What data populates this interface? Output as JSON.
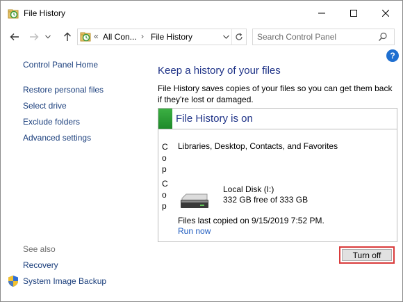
{
  "window": {
    "title": "File History",
    "icon": "file-history-icon"
  },
  "navigation": {
    "back_icon": "arrow-left-icon",
    "forward_icon": "arrow-right-icon",
    "recent_icon": "chevron-down-icon",
    "up_icon": "arrow-up-icon",
    "address": {
      "separator": "«",
      "crumbs": [
        "All Con...",
        "File History"
      ],
      "crumb_separator": "›"
    },
    "refresh_icon": "refresh-icon",
    "search_placeholder": "Search Control Panel"
  },
  "help_label": "?",
  "sidebar": {
    "items": [
      {
        "label": "Control Panel Home"
      },
      {
        "label": "Restore personal files"
      },
      {
        "label": "Select drive"
      },
      {
        "label": "Exclude folders"
      },
      {
        "label": "Advanced settings"
      }
    ],
    "see_also": "See also",
    "see_also_items": [
      {
        "label": "Recovery"
      },
      {
        "label": "System Image Backup"
      }
    ]
  },
  "main": {
    "heading": "Keep a history of your files",
    "description": "File History saves copies of your files so you can get them back if they're lost or damaged.",
    "status": {
      "title": "File History is on",
      "color": "#2e9e3a",
      "clipped_text_1": "Copy files from:",
      "clipped_text_2": "Copy files to:",
      "sources": "Libraries, Desktop, Contacts, and Favorites",
      "drive_name": "Local Disk (I:)",
      "drive_free": "332 GB free of 333 GB",
      "last_copied": "Files last copied on 9/15/2019 7:52 PM.",
      "run_now": "Run now"
    },
    "turn_off": "Turn off"
  },
  "colors": {
    "link": "#1a3e7c",
    "heading": "#1e3287",
    "highlight": "#d93b3b"
  }
}
